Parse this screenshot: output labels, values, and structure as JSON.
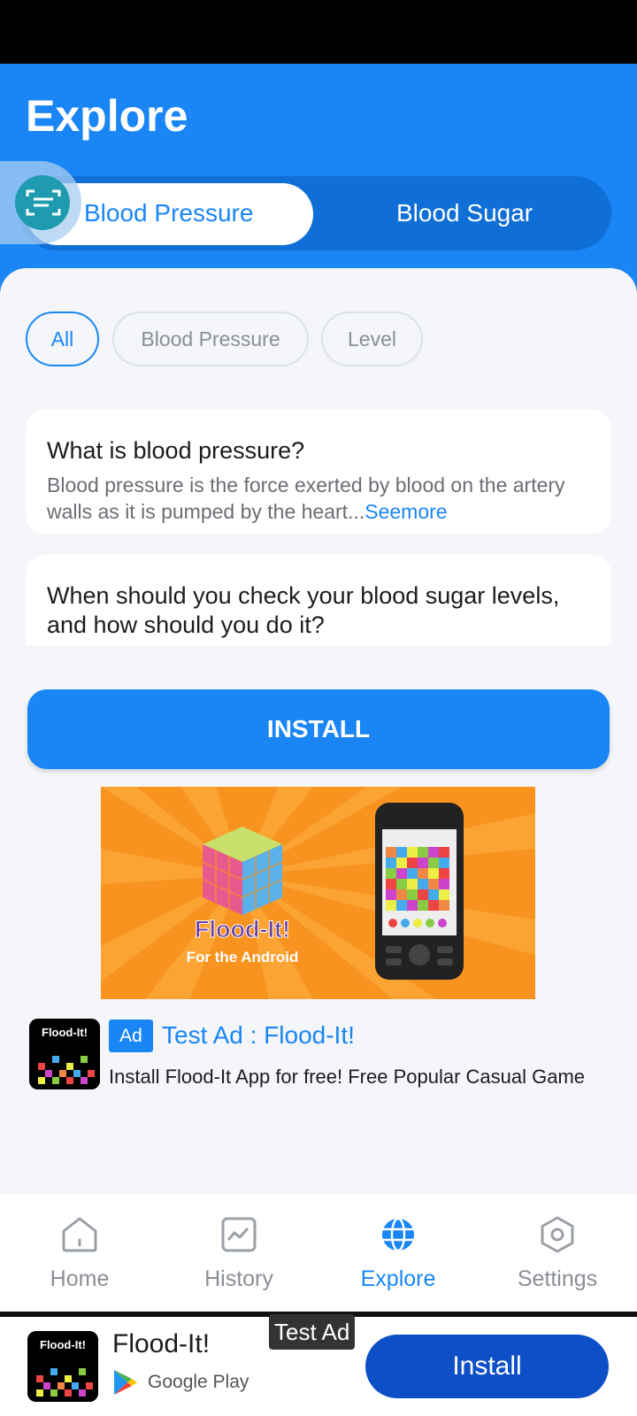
{
  "header": {
    "title": "Explore"
  },
  "segments": [
    {
      "label": "Blood Pressure",
      "active": true
    },
    {
      "label": "Blood Sugar",
      "active": false
    }
  ],
  "filters": [
    {
      "label": "All",
      "active": true
    },
    {
      "label": "Blood Pressure",
      "active": false
    },
    {
      "label": "Level",
      "active": false
    }
  ],
  "articles": [
    {
      "title": "What is blood pressure?",
      "body": "Blood pressure is the force exerted by blood on the artery walls as it is pumped by the heart...",
      "see_more": "Seemore"
    },
    {
      "title": "When should you check your blood sugar levels, and how should you do it?"
    }
  ],
  "install_button": "INSTALL",
  "ad": {
    "badge": "Ad",
    "title": "Test Ad : Flood-It!",
    "description": "Install Flood-It App for free! Free Popular Casual Game",
    "banner_title": "Flood-It!",
    "banner_subtitle": "For the Android",
    "icon_text": "Flood-It!"
  },
  "nav": [
    {
      "label": "Home",
      "icon": "home-icon",
      "active": false
    },
    {
      "label": "History",
      "icon": "chart-icon",
      "active": false
    },
    {
      "label": "Explore",
      "icon": "globe-icon",
      "active": true
    },
    {
      "label": "Settings",
      "icon": "settings-icon",
      "active": false
    }
  ],
  "bottom_ad": {
    "icon_text": "Flood-It!",
    "name": "Flood-It!",
    "store": "Google Play",
    "tag": "Test Ad",
    "install": "Install"
  },
  "colors": {
    "accent": "#1a86f5",
    "segment_bg": "#0f6fd6",
    "install_dark": "#0d4fc7",
    "banner_orange": "#f7931e"
  }
}
